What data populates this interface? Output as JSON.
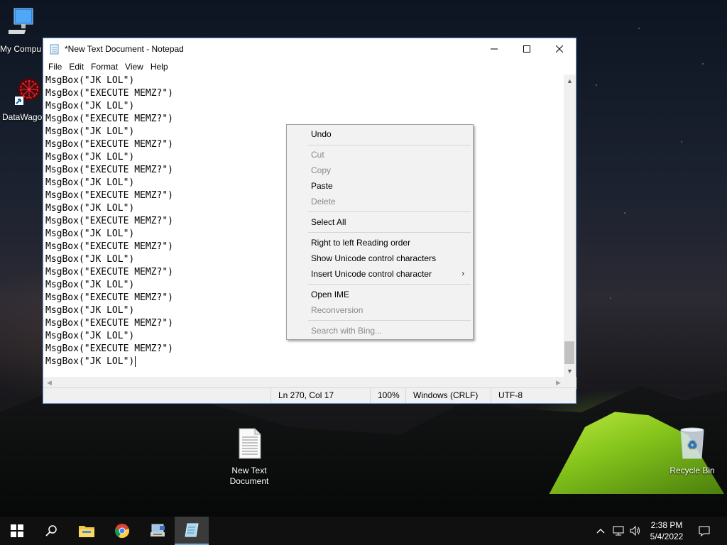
{
  "desktop": {
    "icons": [
      {
        "label": "My Compu"
      },
      {
        "label": "DataWago"
      },
      {
        "label": "New Text Document"
      },
      {
        "label": "Recycle Bin"
      }
    ]
  },
  "window": {
    "title": "*New Text Document - Notepad",
    "menu": [
      "File",
      "Edit",
      "Format",
      "View",
      "Help"
    ],
    "lines": [
      "MsgBox(\"JK LOL\")",
      "MsgBox(\"EXECUTE MEMZ?\")",
      "MsgBox(\"JK LOL\")",
      "MsgBox(\"EXECUTE MEMZ?\")",
      "MsgBox(\"JK LOL\")",
      "MsgBox(\"EXECUTE MEMZ?\")",
      "MsgBox(\"JK LOL\")",
      "MsgBox(\"EXECUTE MEMZ?\")",
      "MsgBox(\"JK LOL\")",
      "MsgBox(\"EXECUTE MEMZ?\")",
      "MsgBox(\"JK LOL\")",
      "MsgBox(\"EXECUTE MEMZ?\")",
      "MsgBox(\"JK LOL\")",
      "MsgBox(\"EXECUTE MEMZ?\")",
      "MsgBox(\"JK LOL\")",
      "MsgBox(\"EXECUTE MEMZ?\")",
      "MsgBox(\"JK LOL\")",
      "MsgBox(\"EXECUTE MEMZ?\")",
      "MsgBox(\"JK LOL\")",
      "MsgBox(\"EXECUTE MEMZ?\")",
      "MsgBox(\"JK LOL\")",
      "MsgBox(\"EXECUTE MEMZ?\")",
      "MsgBox(\"JK LOL\")"
    ],
    "status": {
      "position": "Ln 270, Col 17",
      "zoom": "100%",
      "line_ending": "Windows (CRLF)",
      "encoding": "UTF-8"
    }
  },
  "context_menu": {
    "undo": "Undo",
    "cut": "Cut",
    "copy": "Copy",
    "paste": "Paste",
    "delete": "Delete",
    "select_all": "Select All",
    "rtl": "Right to left Reading order",
    "show_unicode": "Show Unicode control characters",
    "insert_unicode": "Insert Unicode control character",
    "open_ime": "Open IME",
    "reconversion": "Reconversion",
    "search_bing": "Search with Bing...",
    "submenu_arrow": "›"
  },
  "taskbar": {
    "time": "2:38 PM",
    "date": "5/4/2022",
    "icons": [
      "windows-start-icon",
      "search-icon",
      "file-explorer-icon",
      "chrome-icon",
      "network-app-icon",
      "notepad-icon"
    ]
  },
  "colors": {
    "taskbar": "#101010",
    "window_border": "#6d9ad3",
    "menu_bg": "#f2f2f2",
    "disabled_text": "#8a8a8a"
  }
}
